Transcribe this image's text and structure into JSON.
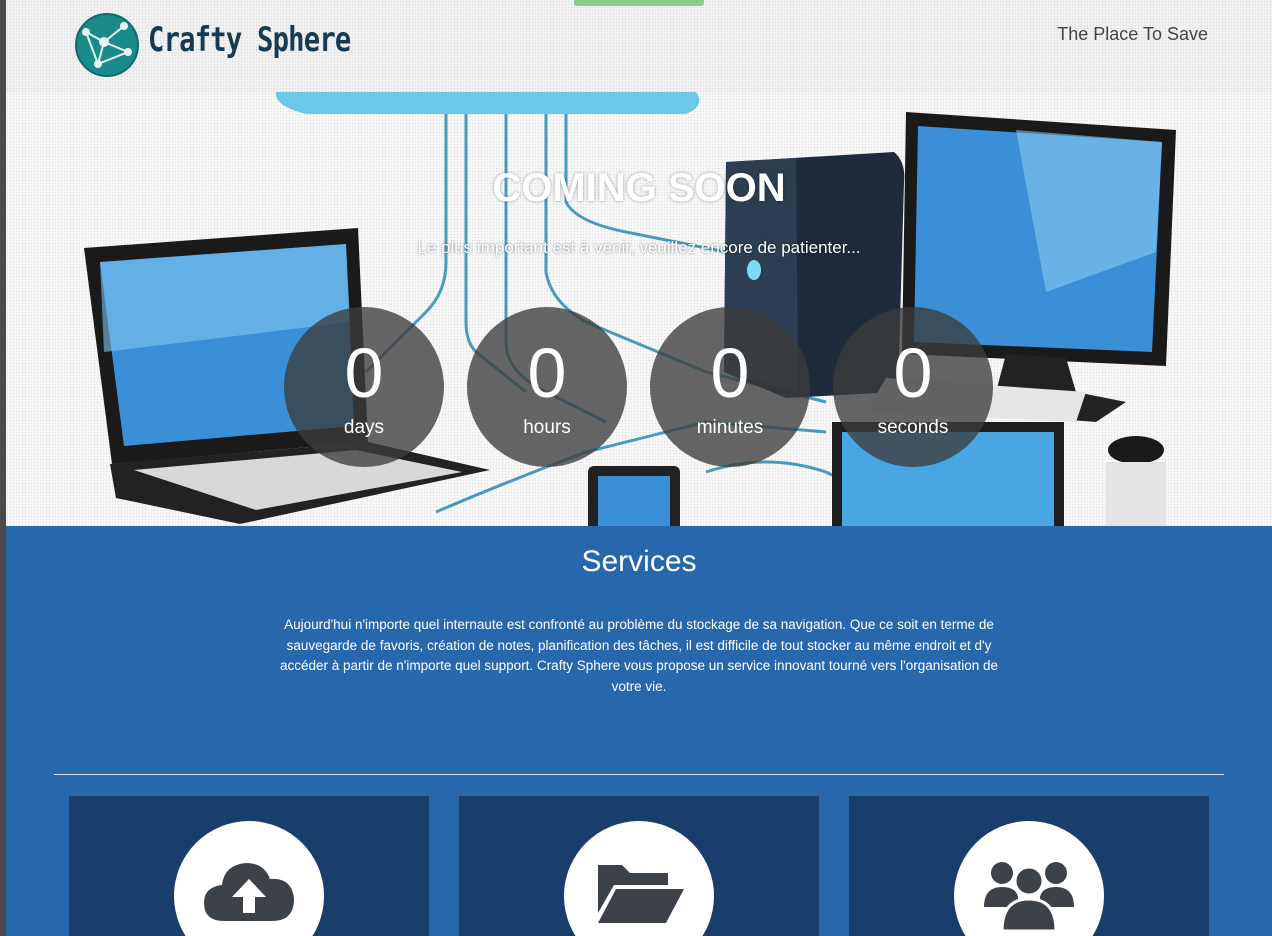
{
  "header": {
    "brand": "Crafty Sphere",
    "tagline": "The Place To Save"
  },
  "hero": {
    "title": "COMING SOON",
    "subtitle": "Le plus important est à venir, veuillez encore de patienter..."
  },
  "countdown": [
    {
      "value": "0",
      "unit": "days"
    },
    {
      "value": "0",
      "unit": "hours"
    },
    {
      "value": "0",
      "unit": "minutes"
    },
    {
      "value": "0",
      "unit": "seconds"
    }
  ],
  "services": {
    "title": "Services",
    "text": "Aujourd'hui n'importe quel internaute est confronté au problème du stockage de sa navigation. Que ce soit en terme de sauvegarde de favoris, création de notes, planification des tâches, il est difficile de tout stocker au même endroit et d'y accéder à partir de n'importe quel support. Crafty Sphere vous propose un service innovant tourné vers l'organisation de votre vie.",
    "cards": [
      {
        "icon": "cloud-upload-icon"
      },
      {
        "icon": "folder-open-icon"
      },
      {
        "icon": "users-icon"
      }
    ]
  },
  "colors": {
    "services_bg": "#2768ad",
    "card_bg": "#1a3e6b",
    "brand_dark": "#153a52",
    "logo_teal": "#1a8a8a"
  }
}
